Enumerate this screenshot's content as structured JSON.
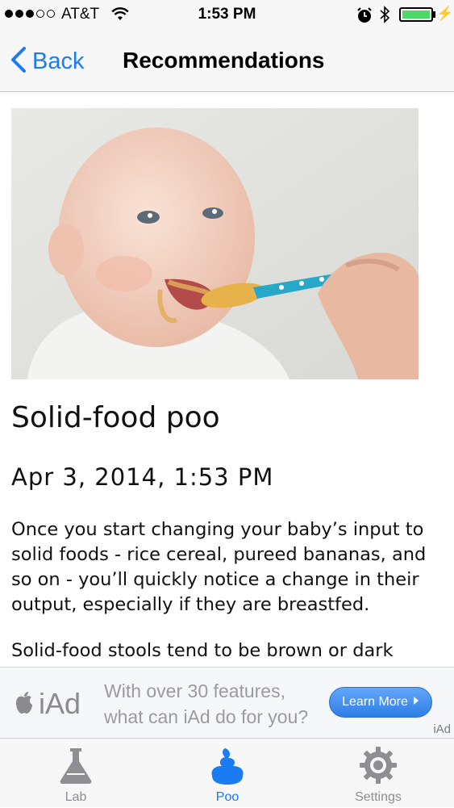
{
  "status_bar": {
    "carrier": "AT&T",
    "time": "1:53 PM",
    "battery_level": 1.0,
    "icons": [
      "signal-dots-icon",
      "wifi-icon",
      "alarm-icon",
      "bluetooth-icon",
      "battery-icon",
      "charging-icon"
    ]
  },
  "nav": {
    "back_label": "Back",
    "title": "Recommendations"
  },
  "article": {
    "image": "baby-eating-from-spoon",
    "title": "Solid-food poo",
    "date": "Apr 3, 2014, 1:53 PM",
    "paragraphs": [
      "Once you start changing your baby’s input to solid foods - rice cereal, pureed bananas, and so on - you’ll quickly notice a change in their output, especially if they are breastfed.",
      "Solid-food stools tend to be brown or dark"
    ]
  },
  "ad": {
    "brand": "iAd",
    "line1": "With over 30 features,",
    "line2": "what can iAd do for you?",
    "button_label": "Learn More",
    "tag": "iAd"
  },
  "tabs": [
    {
      "label": "Lab",
      "icon": "flask-icon",
      "active": false
    },
    {
      "label": "Poo",
      "icon": "poo-icon",
      "active": true
    },
    {
      "label": "Settings",
      "icon": "gear-icon",
      "active": false
    }
  ],
  "colors": {
    "accent": "#1a7bf2",
    "inactive": "#8e8e93",
    "battery": "#4cd964"
  }
}
